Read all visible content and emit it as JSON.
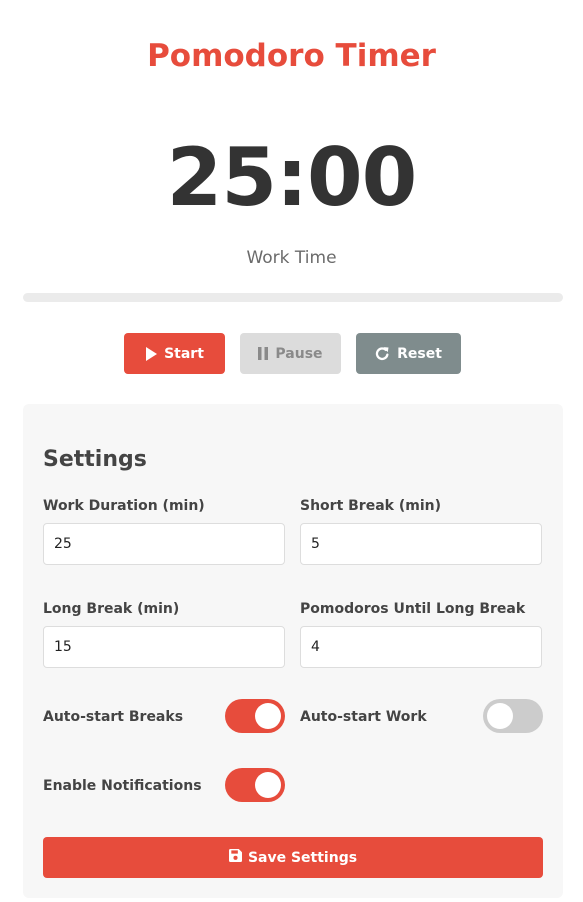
{
  "app": {
    "title": "Pomodoro Timer",
    "timer_display": "25:00",
    "mode_label": "Work Time",
    "progress_percent": 0
  },
  "controls": {
    "start_label": "Start",
    "pause_label": "Pause",
    "reset_label": "Reset"
  },
  "settings": {
    "title": "Settings",
    "fields": [
      {
        "label": "Work Duration (min)",
        "value": "25"
      },
      {
        "label": "Short Break (min)",
        "value": "5"
      },
      {
        "label": "Long Break (min)",
        "value": "15"
      },
      {
        "label": "Pomodoros Until Long Break",
        "value": "4"
      }
    ],
    "toggles": [
      {
        "label": "Auto-start Breaks",
        "on": true
      },
      {
        "label": "Auto-start Work",
        "on": false
      },
      {
        "label": "Enable Notifications",
        "on": true
      }
    ],
    "save_label": "Save Settings"
  },
  "colors": {
    "accent": "#e74c3c",
    "reset_button": "#7f8c8d",
    "disabled_button": "#dcdcdc",
    "toggle_off": "#cccccc"
  },
  "icons": {
    "start": "play-icon",
    "pause": "pause-icon",
    "reset": "redo-icon",
    "save": "floppy-disk-icon"
  }
}
